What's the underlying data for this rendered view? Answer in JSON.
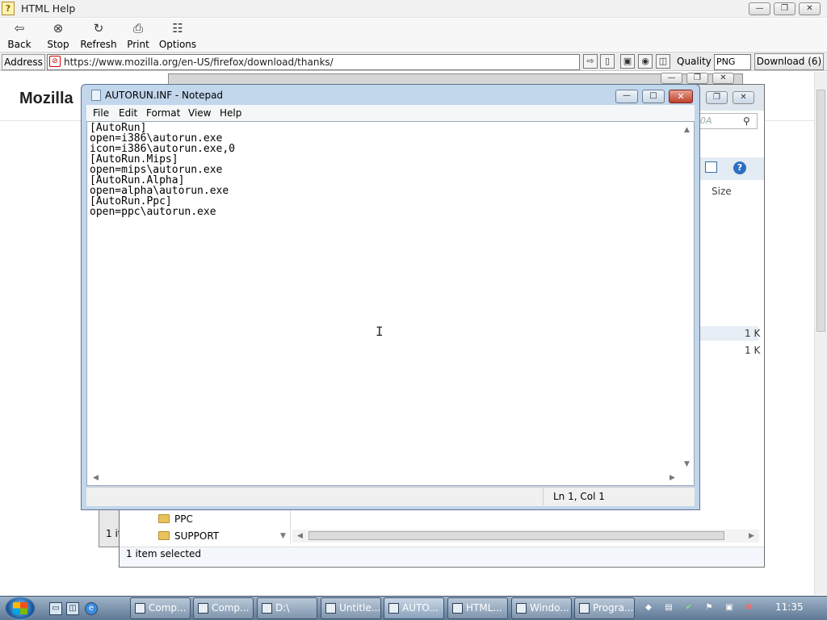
{
  "help_window": {
    "title": "HTML Help",
    "toolbar": [
      {
        "label": "Back",
        "icon": "back-arrow-icon"
      },
      {
        "label": "Stop",
        "icon": "stop-icon"
      },
      {
        "label": "Refresh",
        "icon": "refresh-icon"
      },
      {
        "label": "Print",
        "icon": "print-icon"
      },
      {
        "label": "Options",
        "icon": "options-icon"
      }
    ],
    "address_label": "Address",
    "address_url": "https://www.mozilla.org/en-US/firefox/download/thanks/",
    "quality_label": "Quality",
    "quality_value": "PNG",
    "download_button": "Download (6)",
    "page_heading": "Mozilla"
  },
  "explorer": {
    "search_placeholder": "0A",
    "size_header": "Size",
    "sizes": [
      "1 K",
      "1 K"
    ],
    "folders": [
      "PPC",
      "SUPPORT"
    ],
    "status": "1 item selected",
    "back_status": "1 it"
  },
  "notepad": {
    "title": "AUTORUN.INF - Notepad",
    "menu": [
      "File",
      "Edit",
      "Format",
      "View",
      "Help"
    ],
    "text": "[AutoRun]\nopen=i386\\autorun.exe\nicon=i386\\autorun.exe,0\n[AutoRun.Mips]\nopen=mips\\autorun.exe\n[AutoRun.Alpha]\nopen=alpha\\autorun.exe\n[AutoRun.Ppc]\nopen=ppc\\autorun.exe",
    "status": "Ln 1, Col 1"
  },
  "taskbar": {
    "tasks": [
      "Comp...",
      "Comp...",
      "D:\\",
      "Untitle...",
      "AUTO...",
      "HTML...",
      "Windo...",
      "Progra..."
    ],
    "clock": "11:35"
  },
  "colors": {
    "taskbar": "#6f88a3",
    "notepad_frame": "#c2d6ec",
    "close_button": "#c0402b"
  }
}
